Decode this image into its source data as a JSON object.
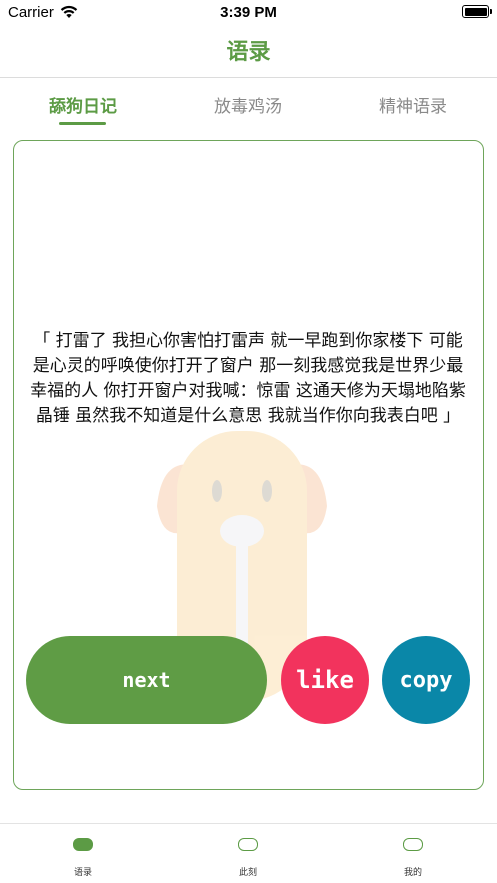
{
  "status_bar": {
    "carrier": "Carrier",
    "time": "3:39 PM"
  },
  "nav": {
    "title": "语录"
  },
  "tabs": [
    {
      "label": "舔狗日记",
      "active": true
    },
    {
      "label": "放毒鸡汤",
      "active": false
    },
    {
      "label": "精神语录",
      "active": false
    }
  ],
  "quote": {
    "text": "「 打雷了 我担心你害怕打雷声 就一早跑到你家楼下 可能是心灵的呼唤使你打开了窗户 那一刻我感觉我是世界少最幸福的人 你打开窗户对我喊：惊雷 这通天修为天塌地陷紫晶锤 虽然我不知道是什么意思 我就当作你向我表白吧 」"
  },
  "buttons": {
    "next": "next",
    "like": "like",
    "copy": "copy"
  },
  "colors": {
    "accent": "#5c9b45",
    "like": "#f2335d",
    "copy": "#0a87a8"
  },
  "tabbar": [
    {
      "label": "语录",
      "icon": "quote-tab-icon",
      "active": true
    },
    {
      "label": "此刻",
      "icon": "moment-tab-icon",
      "active": false
    },
    {
      "label": "我的",
      "icon": "profile-tab-icon",
      "active": false
    }
  ]
}
